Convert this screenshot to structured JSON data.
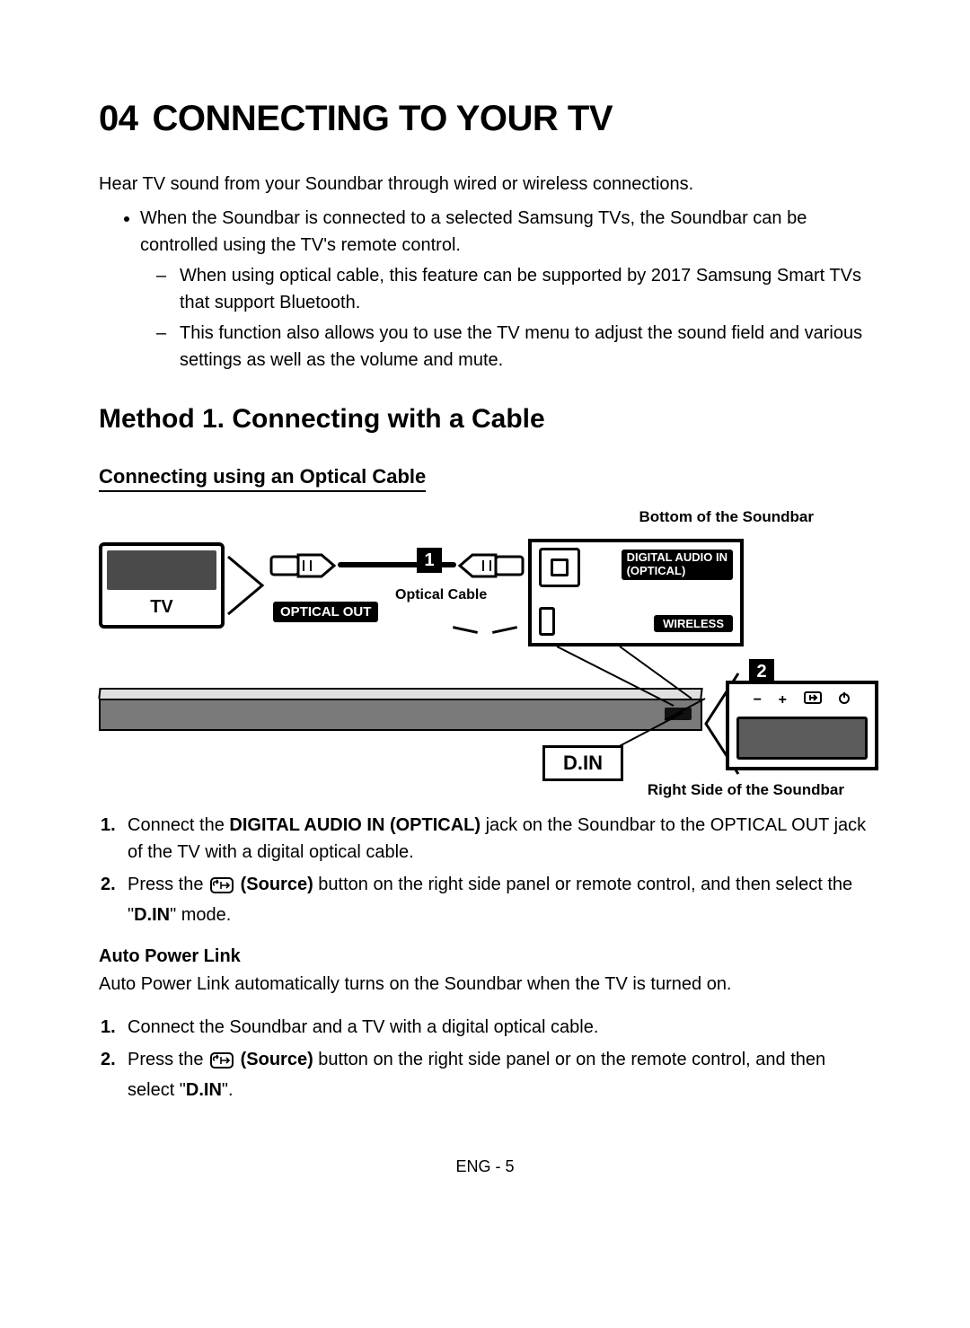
{
  "section": {
    "number": "04",
    "title": "CONNECTING TO YOUR TV"
  },
  "intro": "Hear TV sound from your Soundbar through wired or wireless connections.",
  "bullet1": "When the Soundbar is connected to a selected Samsung TVs, the Soundbar can be controlled using the TV's remote control.",
  "dash1": "When using optical cable, this feature can be supported by 2017 Samsung Smart TVs that support Bluetooth.",
  "dash2": "This function also allows you to use the TV menu to adjust the sound field and various settings as well as the volume and mute.",
  "method_heading": "Method 1. Connecting with a Cable",
  "sub_heading": "Connecting using an Optical Cable",
  "diagram": {
    "top_label": "Bottom of the Soundbar",
    "tv_label": "TV",
    "optical_out": "OPTICAL OUT",
    "optical_cable": "Optical Cable",
    "dai_line1": "DIGITAL AUDIO IN",
    "dai_line2": "(OPTICAL)",
    "wireless": "WIRELESS",
    "num1": "1",
    "num2": "2",
    "din": "D.IN",
    "bottom_label": "Right Side of the Soundbar",
    "side_minus": "−",
    "side_plus": "+"
  },
  "steps_main": {
    "s1_a": "Connect the ",
    "s1_b": "DIGITAL AUDIO IN (OPTICAL)",
    "s1_c": " jack on the Soundbar to the OPTICAL OUT jack of the TV with a digital optical cable.",
    "s2_a": "Press the ",
    "s2_b": " (Source)",
    "s2_c": " button on the right side panel or remote control, and then select the \"",
    "s2_d": "D.IN",
    "s2_e": "\" mode."
  },
  "apl_heading": "Auto Power Link",
  "apl_desc": "Auto Power Link automatically turns on the Soundbar when the TV is turned on.",
  "steps_apl": {
    "s1": "Connect the Soundbar and a TV with a digital optical cable.",
    "s2_a": "Press the ",
    "s2_b": " (Source)",
    "s2_c": " button on the right side panel or on the remote control, and then select \"",
    "s2_d": "D.IN",
    "s2_e": "\"."
  },
  "footer": "ENG - 5"
}
